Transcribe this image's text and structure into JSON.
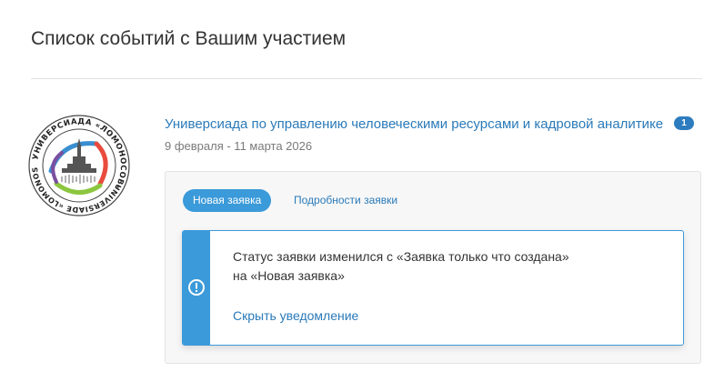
{
  "page": {
    "title": "Список событий с Вашим участием"
  },
  "event": {
    "logo": {
      "ring_text_top": "УНИВЕРСИАДА «ЛОМОНОСОВ»",
      "ring_text_bottom": "UNIVERSIADE «LOMONOSOV»",
      "colors": [
        "#3a8fd0",
        "#e94b3c",
        "#8cc63f",
        "#7b4fa0"
      ]
    },
    "title": "Универсиада по управлению человеческими ресурсами и кадровой аналитике",
    "badge_count": "1",
    "dates": "9 февраля - 11 марта 2026"
  },
  "application": {
    "status_tab_label": "Новая заявка",
    "details_tab_label": "Подробности заявки",
    "notification": {
      "icon": "info-circle-icon",
      "line1": "Статус заявки изменился с «Заявка только что создана»",
      "line2": "на «Новая заявка»",
      "hide_link": "Скрыть уведомление"
    }
  },
  "colors": {
    "accent": "#3b9ad9",
    "link": "#2a7ab9",
    "badge": "#2c7cbf"
  }
}
